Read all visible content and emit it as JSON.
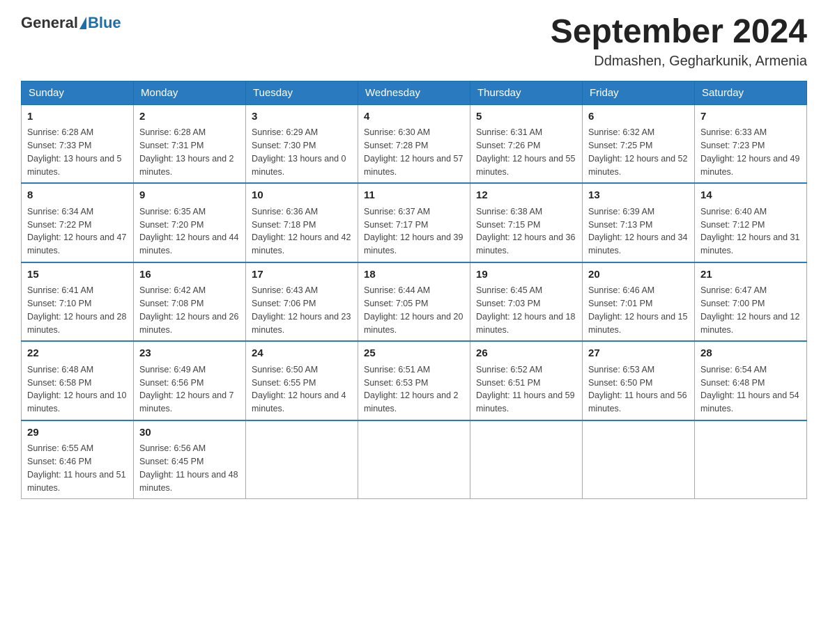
{
  "header": {
    "logo_general": "General",
    "logo_blue": "Blue",
    "month_title": "September 2024",
    "location": "Ddmashen, Gegharkunik, Armenia"
  },
  "weekdays": [
    "Sunday",
    "Monday",
    "Tuesday",
    "Wednesday",
    "Thursday",
    "Friday",
    "Saturday"
  ],
  "weeks": [
    [
      {
        "day": "1",
        "sunrise": "6:28 AM",
        "sunset": "7:33 PM",
        "daylight": "13 hours and 5 minutes."
      },
      {
        "day": "2",
        "sunrise": "6:28 AM",
        "sunset": "7:31 PM",
        "daylight": "13 hours and 2 minutes."
      },
      {
        "day": "3",
        "sunrise": "6:29 AM",
        "sunset": "7:30 PM",
        "daylight": "13 hours and 0 minutes."
      },
      {
        "day": "4",
        "sunrise": "6:30 AM",
        "sunset": "7:28 PM",
        "daylight": "12 hours and 57 minutes."
      },
      {
        "day": "5",
        "sunrise": "6:31 AM",
        "sunset": "7:26 PM",
        "daylight": "12 hours and 55 minutes."
      },
      {
        "day": "6",
        "sunrise": "6:32 AM",
        "sunset": "7:25 PM",
        "daylight": "12 hours and 52 minutes."
      },
      {
        "day": "7",
        "sunrise": "6:33 AM",
        "sunset": "7:23 PM",
        "daylight": "12 hours and 49 minutes."
      }
    ],
    [
      {
        "day": "8",
        "sunrise": "6:34 AM",
        "sunset": "7:22 PM",
        "daylight": "12 hours and 47 minutes."
      },
      {
        "day": "9",
        "sunrise": "6:35 AM",
        "sunset": "7:20 PM",
        "daylight": "12 hours and 44 minutes."
      },
      {
        "day": "10",
        "sunrise": "6:36 AM",
        "sunset": "7:18 PM",
        "daylight": "12 hours and 42 minutes."
      },
      {
        "day": "11",
        "sunrise": "6:37 AM",
        "sunset": "7:17 PM",
        "daylight": "12 hours and 39 minutes."
      },
      {
        "day": "12",
        "sunrise": "6:38 AM",
        "sunset": "7:15 PM",
        "daylight": "12 hours and 36 minutes."
      },
      {
        "day": "13",
        "sunrise": "6:39 AM",
        "sunset": "7:13 PM",
        "daylight": "12 hours and 34 minutes."
      },
      {
        "day": "14",
        "sunrise": "6:40 AM",
        "sunset": "7:12 PM",
        "daylight": "12 hours and 31 minutes."
      }
    ],
    [
      {
        "day": "15",
        "sunrise": "6:41 AM",
        "sunset": "7:10 PM",
        "daylight": "12 hours and 28 minutes."
      },
      {
        "day": "16",
        "sunrise": "6:42 AM",
        "sunset": "7:08 PM",
        "daylight": "12 hours and 26 minutes."
      },
      {
        "day": "17",
        "sunrise": "6:43 AM",
        "sunset": "7:06 PM",
        "daylight": "12 hours and 23 minutes."
      },
      {
        "day": "18",
        "sunrise": "6:44 AM",
        "sunset": "7:05 PM",
        "daylight": "12 hours and 20 minutes."
      },
      {
        "day": "19",
        "sunrise": "6:45 AM",
        "sunset": "7:03 PM",
        "daylight": "12 hours and 18 minutes."
      },
      {
        "day": "20",
        "sunrise": "6:46 AM",
        "sunset": "7:01 PM",
        "daylight": "12 hours and 15 minutes."
      },
      {
        "day": "21",
        "sunrise": "6:47 AM",
        "sunset": "7:00 PM",
        "daylight": "12 hours and 12 minutes."
      }
    ],
    [
      {
        "day": "22",
        "sunrise": "6:48 AM",
        "sunset": "6:58 PM",
        "daylight": "12 hours and 10 minutes."
      },
      {
        "day": "23",
        "sunrise": "6:49 AM",
        "sunset": "6:56 PM",
        "daylight": "12 hours and 7 minutes."
      },
      {
        "day": "24",
        "sunrise": "6:50 AM",
        "sunset": "6:55 PM",
        "daylight": "12 hours and 4 minutes."
      },
      {
        "day": "25",
        "sunrise": "6:51 AM",
        "sunset": "6:53 PM",
        "daylight": "12 hours and 2 minutes."
      },
      {
        "day": "26",
        "sunrise": "6:52 AM",
        "sunset": "6:51 PM",
        "daylight": "11 hours and 59 minutes."
      },
      {
        "day": "27",
        "sunrise": "6:53 AM",
        "sunset": "6:50 PM",
        "daylight": "11 hours and 56 minutes."
      },
      {
        "day": "28",
        "sunrise": "6:54 AM",
        "sunset": "6:48 PM",
        "daylight": "11 hours and 54 minutes."
      }
    ],
    [
      {
        "day": "29",
        "sunrise": "6:55 AM",
        "sunset": "6:46 PM",
        "daylight": "11 hours and 51 minutes."
      },
      {
        "day": "30",
        "sunrise": "6:56 AM",
        "sunset": "6:45 PM",
        "daylight": "11 hours and 48 minutes."
      },
      null,
      null,
      null,
      null,
      null
    ]
  ]
}
